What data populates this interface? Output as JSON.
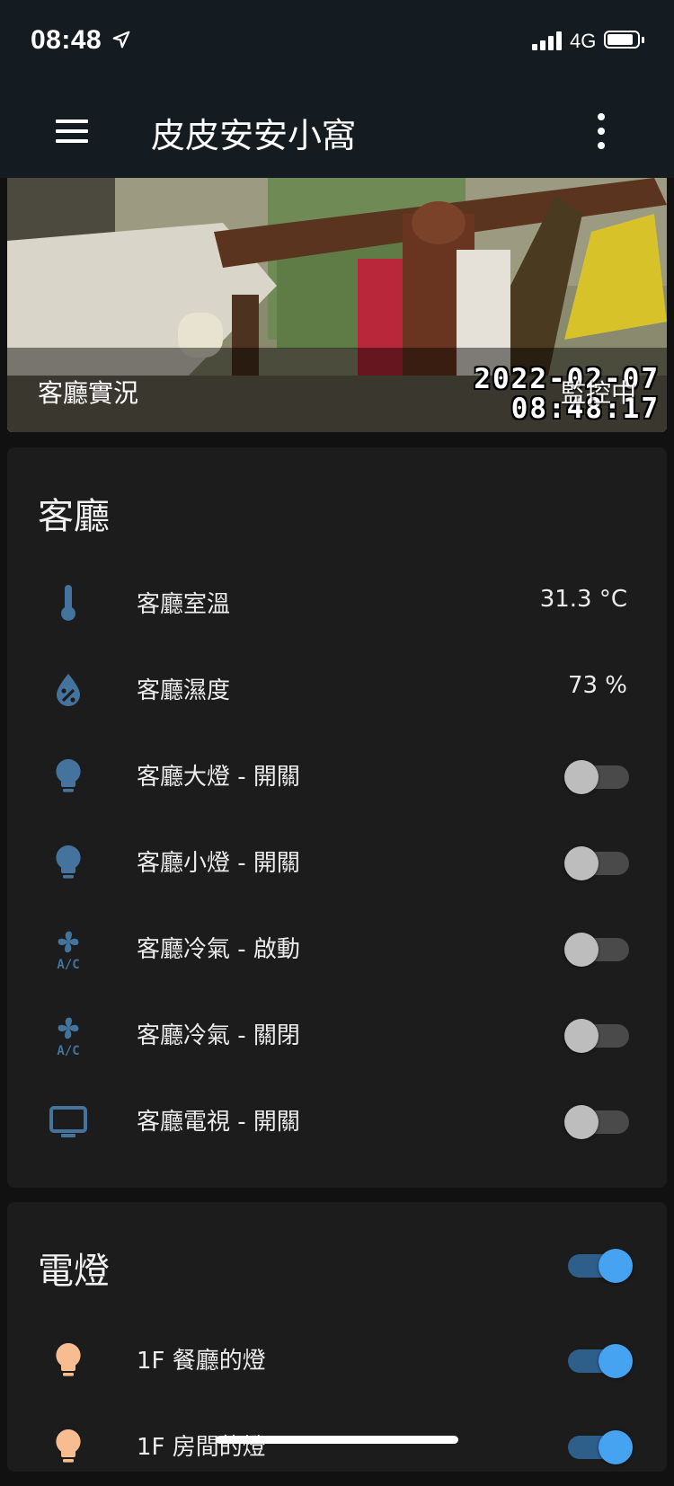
{
  "status_bar": {
    "time": "08:48",
    "network": "4G",
    "location_icon": "location-arrow-icon",
    "signal_icon": "cellular-signal-icon",
    "battery_icon": "battery-icon"
  },
  "app_bar": {
    "title": "皮皮安安小窩",
    "menu_icon": "hamburger-menu-icon",
    "more_icon": "more-vertical-icon"
  },
  "camera": {
    "title": "客廳實況",
    "status": "監控中",
    "timestamp_date": "2022-02-07",
    "timestamp_time": "08:48:17"
  },
  "living_room": {
    "title": "客廳",
    "rows": [
      {
        "icon": "thermometer-icon",
        "label": "客廳室溫",
        "value": "31.3 °C"
      },
      {
        "icon": "water-percent-icon",
        "label": "客廳濕度",
        "value": "73 %"
      },
      {
        "icon": "lightbulb-icon",
        "label": "客廳大燈 - 開關",
        "state": "off"
      },
      {
        "icon": "lightbulb-icon",
        "label": "客廳小燈 - 開關",
        "state": "off"
      },
      {
        "icon": "air-conditioner-icon",
        "label": "客廳冷氣 - 啟動",
        "state": "off"
      },
      {
        "icon": "air-conditioner-icon",
        "label": "客廳冷氣 - 關閉",
        "state": "off"
      },
      {
        "icon": "television-icon",
        "label": "客廳電視 - 開關",
        "state": "off"
      }
    ]
  },
  "lights": {
    "title": "電燈",
    "master_state": "on",
    "rows": [
      {
        "icon": "lightbulb-icon",
        "label": "1F 餐廳的燈",
        "state": "on"
      },
      {
        "icon": "lightbulb-icon",
        "label": "1F 房間的燈",
        "state": "on"
      }
    ]
  },
  "colors": {
    "icon_off": "#44739e",
    "icon_on": "#f7bc8f",
    "toggle_on": "#45a3f1",
    "card_bg": "#1c1c1c",
    "app_bar": "#141c22"
  }
}
